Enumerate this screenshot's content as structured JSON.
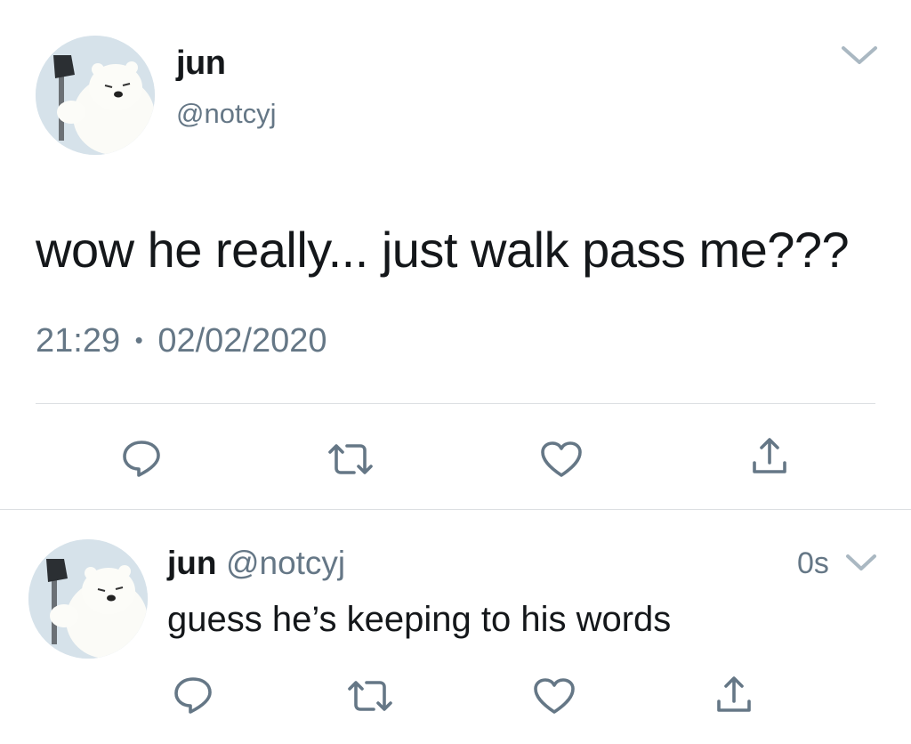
{
  "main_tweet": {
    "display_name": "jun",
    "handle": "@notcyj",
    "avatar_icon": "polar-bear-with-axe-avatar",
    "menu_icon": "chevron-down-icon",
    "text": "wow he really... just walk pass me???",
    "time": "21:29",
    "separator": "•",
    "date": "02/02/2020",
    "actions": [
      "reply-icon",
      "retweet-icon",
      "like-icon",
      "share-icon"
    ]
  },
  "reply_tweet": {
    "display_name": "jun",
    "handle": "@notcyj",
    "timestamp": "0s",
    "avatar_icon": "polar-bear-with-axe-avatar",
    "menu_icon": "chevron-down-icon",
    "text": "guess he’s keeping to his words",
    "actions": [
      "reply-icon",
      "retweet-icon",
      "like-icon",
      "share-icon"
    ]
  },
  "colors": {
    "primary_text": "#14171a",
    "secondary_text": "#657786",
    "divider": "#dcdfe2",
    "chevron": "#aab8c2"
  }
}
